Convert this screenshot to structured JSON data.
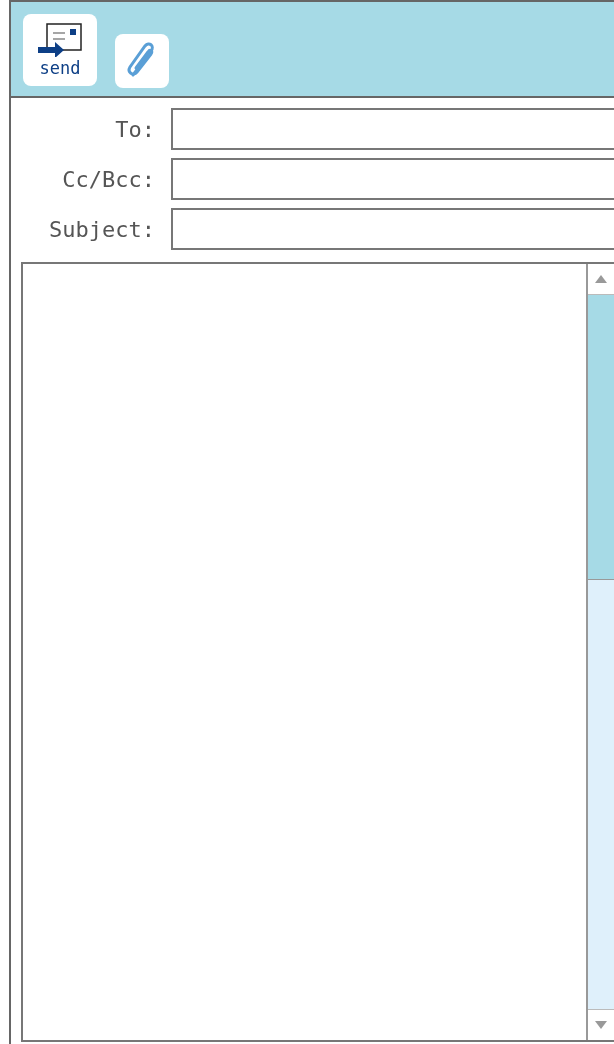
{
  "toolbar": {
    "send_button": {
      "label": "send"
    }
  },
  "fields": [
    {
      "label": "To:"
    },
    {
      "label": "Cc/Bcc:"
    },
    {
      "label": "Subject:"
    }
  ]
}
